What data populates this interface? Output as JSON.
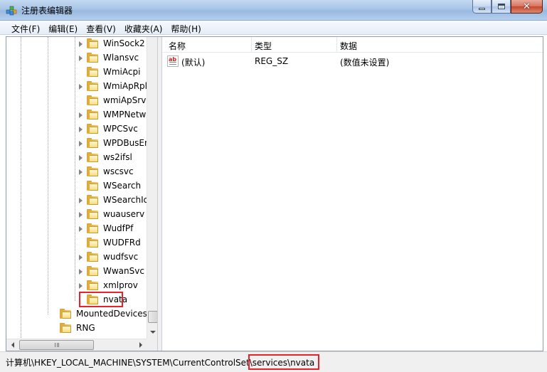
{
  "window": {
    "title": "注册表编辑器",
    "icon": "regedit-icon"
  },
  "menu": [
    "文件(F)",
    "编辑(E)",
    "查看(V)",
    "收藏夹(A)",
    "帮助(H)"
  ],
  "tree": {
    "items": [
      {
        "label": "WinSock2",
        "expandable": true
      },
      {
        "label": "Wlansvc",
        "expandable": true
      },
      {
        "label": "WmiAcpi",
        "expandable": false
      },
      {
        "label": "WmiApRpl",
        "expandable": true
      },
      {
        "label": "wmiApSrv",
        "expandable": false
      },
      {
        "label": "WMPNetwo",
        "expandable": true
      },
      {
        "label": "WPCSvc",
        "expandable": true
      },
      {
        "label": "WPDBusEnu",
        "expandable": true
      },
      {
        "label": "ws2ifsl",
        "expandable": true
      },
      {
        "label": "wscsvc",
        "expandable": true
      },
      {
        "label": "WSearch",
        "expandable": false
      },
      {
        "label": "WSearchIdx",
        "expandable": true
      },
      {
        "label": "wuauserv",
        "expandable": true
      },
      {
        "label": "WudfPf",
        "expandable": true
      },
      {
        "label": "WUDFRd",
        "expandable": false
      },
      {
        "label": "wudfsvc",
        "expandable": true
      },
      {
        "label": "WwanSvc",
        "expandable": true
      },
      {
        "label": "xmlprov",
        "expandable": true
      },
      {
        "label": "nvata",
        "expandable": false,
        "highlighted": true
      }
    ],
    "siblings": [
      {
        "label": "MountedDevices"
      },
      {
        "label": "RNG"
      }
    ]
  },
  "list": {
    "columns": [
      "名称",
      "类型",
      "数据"
    ],
    "rows": [
      {
        "name": "(默认)",
        "type": "REG_SZ",
        "data": "(数值未设置)",
        "icon": "string-value-icon"
      }
    ]
  },
  "status": {
    "path_prefix": "计算机\\HKEY_LOCAL_MACHINE\\SYSTEM\\CurrentControlSet\\",
    "path_highlight": "services\\nvata"
  },
  "colors": {
    "highlight_border": "#e8212a",
    "titlebar": "#a8c4e6"
  }
}
